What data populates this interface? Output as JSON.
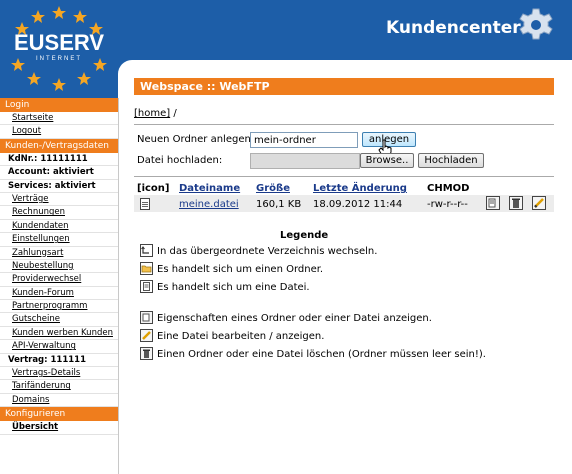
{
  "header": {
    "title": "Kundencenter",
    "logo_text": "EUSERV",
    "logo_sub": "INTERNET"
  },
  "sidebar": [
    {
      "type": "head",
      "label": "Login"
    },
    {
      "type": "item",
      "label": "Startseite"
    },
    {
      "type": "item",
      "label": "Logout"
    },
    {
      "type": "head",
      "label": "Kunden-/Vertragsdaten"
    },
    {
      "type": "info",
      "label": "KdNr.: 11111111"
    },
    {
      "type": "info",
      "label": "Account: aktiviert"
    },
    {
      "type": "info",
      "label": "Services: aktiviert"
    },
    {
      "type": "item",
      "label": "Verträge"
    },
    {
      "type": "item",
      "label": "Rechnungen"
    },
    {
      "type": "item",
      "label": "Kundendaten"
    },
    {
      "type": "item",
      "label": "Einstellungen"
    },
    {
      "type": "item",
      "label": "Zahlungsart"
    },
    {
      "type": "item",
      "label": "Neubestellung"
    },
    {
      "type": "item",
      "label": "Providerwechsel"
    },
    {
      "type": "item",
      "label": "Kunden-Forum"
    },
    {
      "type": "item",
      "label": "Partnerprogramm"
    },
    {
      "type": "item",
      "label": "Gutscheine"
    },
    {
      "type": "item",
      "label": "Kunden werben Kunden"
    },
    {
      "type": "item",
      "label": "API-Verwaltung"
    },
    {
      "type": "info",
      "label": "Vertrag: 111111"
    },
    {
      "type": "item",
      "label": "Vertrags-Details"
    },
    {
      "type": "item",
      "label": "Tarifänderung"
    },
    {
      "type": "item",
      "label": "Domains"
    },
    {
      "type": "head",
      "label": "Konfigurieren"
    },
    {
      "type": "active",
      "label": "Übersicht"
    }
  ],
  "main": {
    "title": "Webspace :: WebFTP",
    "breadcrumb_link": "[home]",
    "breadcrumb_sep": "/",
    "new_folder_label": "Neuen Ordner anlegen:",
    "new_folder_value": "mein-ordner",
    "new_folder_button": "anlegen",
    "upload_label": "Datei hochladen:",
    "browse_button": "Browse..",
    "upload_button": "Hochladen"
  },
  "table": {
    "headers": {
      "icon": "[icon]",
      "name": "Dateiname",
      "size": "Größe",
      "changed": "Letzte Änderung",
      "chmod": "CHMOD"
    },
    "row": {
      "name": "meine.datei",
      "size": "160,1 KB",
      "changed": "18.09.2012 11:44",
      "chmod": "-rw-r--r--"
    }
  },
  "legend": {
    "title": "Legende",
    "items": [
      "In das übergeordnete Verzeichnis wechseln.",
      "Es handelt sich um einen Ordner.",
      "Es handelt sich um eine Datei.",
      "Eigenschaften eines Ordner oder einer Datei anzeigen.",
      "Eine Datei bearbeiten / anzeigen.",
      "Einen Ordner oder eine Datei löschen (Ordner müssen leer sein!)."
    ]
  },
  "colors": {
    "header_blue": "#1d5ea8",
    "accent_orange": "#ef7d1d"
  }
}
